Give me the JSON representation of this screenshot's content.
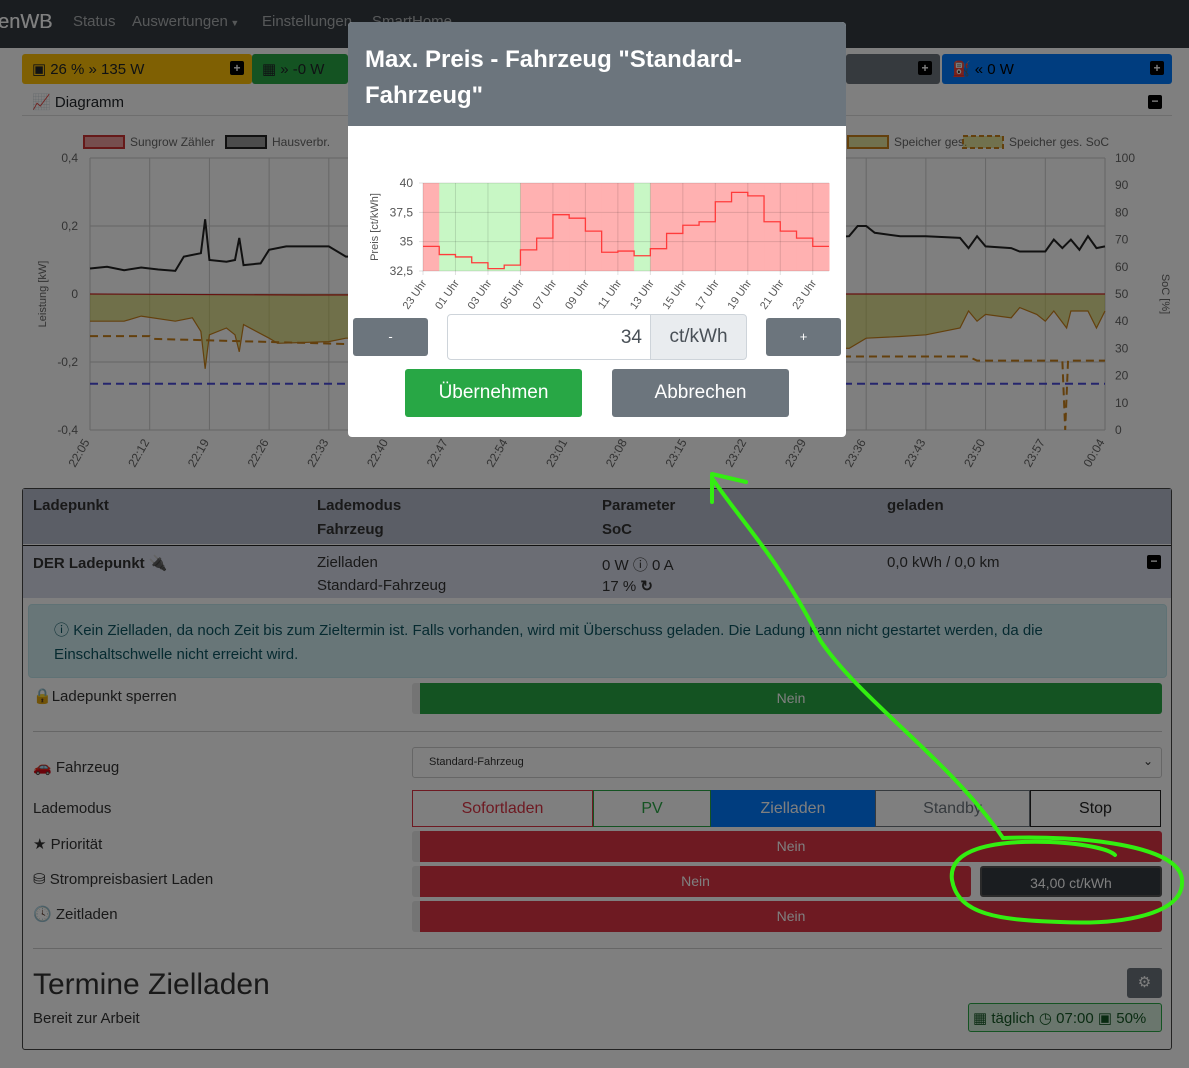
{
  "nav": {
    "brand": "openWB",
    "brand_visible": "enWB",
    "items": [
      "Status",
      "Auswertungen",
      "Einstellungen",
      "SmartHome"
    ]
  },
  "cards": {
    "battery": {
      "text": "26 % » 135 W",
      "color": "#ffc107"
    },
    "pv": {
      "text": "» -0 W",
      "color": "#28a745"
    },
    "evu": {
      "color": "#343a40"
    },
    "lp": {
      "text": "« 0 W",
      "color": "#007bff"
    }
  },
  "diagram": {
    "title": "Diagramm"
  },
  "chart_data": [
    {
      "type": "line",
      "ylabel": "Leistung [kW]",
      "y2label": "SoC [%]",
      "ylim": [
        -0.4,
        0.4
      ],
      "y2lim": [
        0,
        100
      ],
      "yticks": [
        "0,4",
        "0,2",
        "0",
        "-0,2",
        "-0,4"
      ],
      "y2ticks": [
        "100",
        "90",
        "80",
        "70",
        "60",
        "50",
        "40",
        "30",
        "20",
        "10",
        "0"
      ],
      "xticks": [
        "22:05",
        "22:12",
        "22:19",
        "22:26",
        "22:33",
        "22:40",
        "22:47",
        "22:54",
        "23:01",
        "23:08",
        "23:15",
        "23:22",
        "23:29",
        "23:36",
        "23:43",
        "23:50",
        "23:57",
        "00:04"
      ],
      "legend": [
        "Sungrow Zähler",
        "Hausverbr.",
        "Speicher ges.",
        "Speicher ges. SoC"
      ],
      "grid": true,
      "legend_position": "top",
      "series": [
        {
          "name": "Hausverbr.",
          "color": "#222222",
          "points": [
            [
              "22:05",
              0.075
            ],
            [
              "22:07",
              0.08
            ],
            [
              "22:09",
              0.07
            ],
            [
              "22:11",
              0.078
            ],
            [
              "22:13",
              0.072
            ],
            [
              "22:15",
              0.068
            ],
            [
              "22:16",
              0.11
            ],
            [
              "22:18",
              0.12
            ],
            [
              "22:18:30",
              0.22
            ],
            [
              "22:19",
              0.1
            ],
            [
              "22:21",
              0.095
            ],
            [
              "22:22",
              0.1
            ],
            [
              "22:22:30",
              0.165
            ],
            [
              "22:23",
              0.085
            ],
            [
              "22:25",
              0.09
            ],
            [
              "22:26",
              0.13
            ],
            [
              "22:28",
              0.14
            ],
            [
              "22:33",
              0.14
            ],
            [
              "22:35",
              0.11
            ],
            [
              "23:00",
              0.12
            ],
            [
              "23:34",
              0.17
            ],
            [
              "23:35",
              0.2
            ],
            [
              "23:36",
              0.2
            ],
            [
              "23:37",
              0.18
            ],
            [
              "23:40",
              0.17
            ],
            [
              "23:43",
              0.17
            ],
            [
              "23:47",
              0.165
            ],
            [
              "23:48",
              0.135
            ],
            [
              "23:49",
              0.17
            ],
            [
              "23:50",
              0.14
            ],
            [
              "23:53",
              0.135
            ],
            [
              "23:54",
              0.125
            ],
            [
              "23:57",
              0.125
            ],
            [
              "23:58",
              0.16
            ],
            [
              "23:59",
              0.135
            ],
            [
              "00:00",
              0.16
            ],
            [
              "00:01",
              0.13
            ],
            [
              "00:02",
              0.17
            ],
            [
              "00:03",
              0.135
            ],
            [
              "00:04",
              0.14
            ]
          ]
        },
        {
          "name": "Speicher ges.",
          "color": "#c8801a",
          "points": [
            [
              "22:05",
              -0.08
            ],
            [
              "22:09",
              -0.08
            ],
            [
              "22:11",
              -0.065
            ],
            [
              "22:15",
              -0.08
            ],
            [
              "22:17",
              -0.07
            ],
            [
              "22:18",
              -0.11
            ],
            [
              "22:18:30",
              -0.22
            ],
            [
              "22:19",
              -0.12
            ],
            [
              "22:21",
              -0.1
            ],
            [
              "22:22",
              -0.12
            ],
            [
              "22:22:30",
              -0.17
            ],
            [
              "22:23",
              -0.09
            ],
            [
              "22:26",
              -0.13
            ],
            [
              "22:27",
              -0.145
            ],
            [
              "22:33",
              -0.14
            ],
            [
              "22:35",
              -0.13
            ],
            [
              "23:00",
              -0.13
            ],
            [
              "23:34",
              -0.16
            ],
            [
              "23:36",
              -0.13
            ],
            [
              "23:40",
              -0.125
            ],
            [
              "23:43",
              -0.12
            ],
            [
              "23:47",
              -0.1
            ],
            [
              "23:48",
              -0.05
            ],
            [
              "23:49",
              -0.08
            ],
            [
              "23:50",
              -0.06
            ],
            [
              "23:53",
              -0.07
            ],
            [
              "23:54",
              -0.04
            ],
            [
              "23:56",
              -0.06
            ],
            [
              "23:57",
              -0.08
            ],
            [
              "23:58",
              -0.05
            ],
            [
              "23:59:30",
              -0.1
            ],
            [
              "00:00",
              -0.05
            ],
            [
              "00:02",
              -0.05
            ],
            [
              "00:03",
              -0.1
            ],
            [
              "00:04",
              -0.05
            ]
          ]
        },
        {
          "name": "Sungrow Zähler",
          "color": "#cc2222",
          "points": [
            [
              "22:05",
              0
            ],
            [
              "22:30",
              -0.003
            ],
            [
              "23:30",
              0
            ],
            [
              "00:04",
              0
            ]
          ]
        }
      ],
      "soc_series": [
        {
          "name": "Speicher ges. SoC",
          "color": "#c8801a",
          "points": [
            [
              "22:05",
              34.5
            ],
            [
              "22:12",
              34.5
            ],
            [
              "22:12:30",
              33.5
            ],
            [
              "23:30",
              27
            ],
            [
              "23:48",
              27
            ],
            [
              "23:49",
              25.5
            ],
            [
              "23:59",
              25.5
            ],
            [
              "23:59:20",
              0
            ],
            [
              "23:59:40",
              25.5
            ],
            [
              "00:04",
              25.5
            ]
          ]
        },
        {
          "color": "#4a4adb",
          "points": [
            [
              "22:05",
              17
            ],
            [
              "00:04",
              17
            ]
          ]
        }
      ]
    },
    {
      "type": "line",
      "step": true,
      "ylabel": "Preis [ct/kWh]",
      "ylim": [
        32.5,
        40
      ],
      "yticks": [
        "40",
        "37,5",
        "35",
        "32,5"
      ],
      "xticks": [
        "23 Uhr",
        "01 Uhr",
        "03 Uhr",
        "05 Uhr",
        "07 Uhr",
        "09 Uhr",
        "11 Uhr",
        "13 Uhr",
        "15 Uhr",
        "17 Uhr",
        "19 Uhr",
        "21 Uhr",
        "23 Uhr"
      ],
      "hours": [
        "23",
        "00",
        "01",
        "02",
        "03",
        "04",
        "05",
        "06",
        "07",
        "08",
        "09",
        "10",
        "11",
        "12",
        "13",
        "14",
        "15",
        "16",
        "17",
        "18",
        "19",
        "20",
        "21",
        "22",
        "23"
      ],
      "values": [
        34.6,
        33.9,
        33.7,
        33.2,
        32.7,
        33.0,
        34.3,
        35.3,
        37.3,
        37.0,
        35.9,
        34.1,
        34.2,
        33.8,
        34.4,
        35.7,
        36.4,
        36.7,
        38.4,
        39.2,
        38.9,
        36.7,
        35.9,
        35.3,
        34.6
      ],
      "max_price": 34,
      "below_color": "#c8f7c5",
      "above_color": "#ffb1b1",
      "line_color": "#ff3b3b"
    }
  ],
  "ladepunkt": {
    "headers": {
      "c1": "Ladepunkt",
      "c2a": "Lademodus",
      "c2b": "Fahrzeug",
      "c3a": "Parameter",
      "c3b": "SoC",
      "c4": "geladen"
    },
    "name": "DER Ladepunkt",
    "mode": "Zielladen",
    "vehicle": "Standard-Fahrzeug",
    "power": "0 W ⓘ 0 A",
    "soc": "17 %",
    "charged": "0,0 kWh / 0,0 km",
    "alert": "Kein Zielladen, da noch Zeit bis zum Zieltermin ist. Falls vorhanden, wird mit Überschuss geladen. Die Ladung kann nicht gestartet werden, da die Einschaltschwelle nicht erreicht wird.",
    "lock_label": "Ladepunkt sperren",
    "lock_value": "Nein",
    "vehicle_label": "Fahrzeug",
    "vehicle_select": "Standard-Fahrzeug",
    "mode_label": "Lademodus",
    "modes": [
      "Sofortladen",
      "PV",
      "Zielladen",
      "Standby",
      "Stop"
    ],
    "priority_label": "Priorität",
    "priority_value": "Nein",
    "price_label": "Strompreisbasiert Laden",
    "price_value": "Nein",
    "price_button": "34,00 ct/kWh",
    "time_label": "Zeitladen",
    "time_value": "Nein",
    "plan_title": "Termine Zielladen",
    "plan_name": "Bereit zur Arbeit",
    "plan_freq": "täglich",
    "plan_time": "07:00",
    "plan_soc": "50%"
  },
  "modal": {
    "title": "Max. Preis - Fahrzeug \"Standard-Fahrzeug\"",
    "minus": "-",
    "plus": "+",
    "value": "34",
    "unit": "ct/kWh",
    "apply": "Übernehmen",
    "cancel": "Abbrechen"
  },
  "annotation_color": "#33ee11"
}
